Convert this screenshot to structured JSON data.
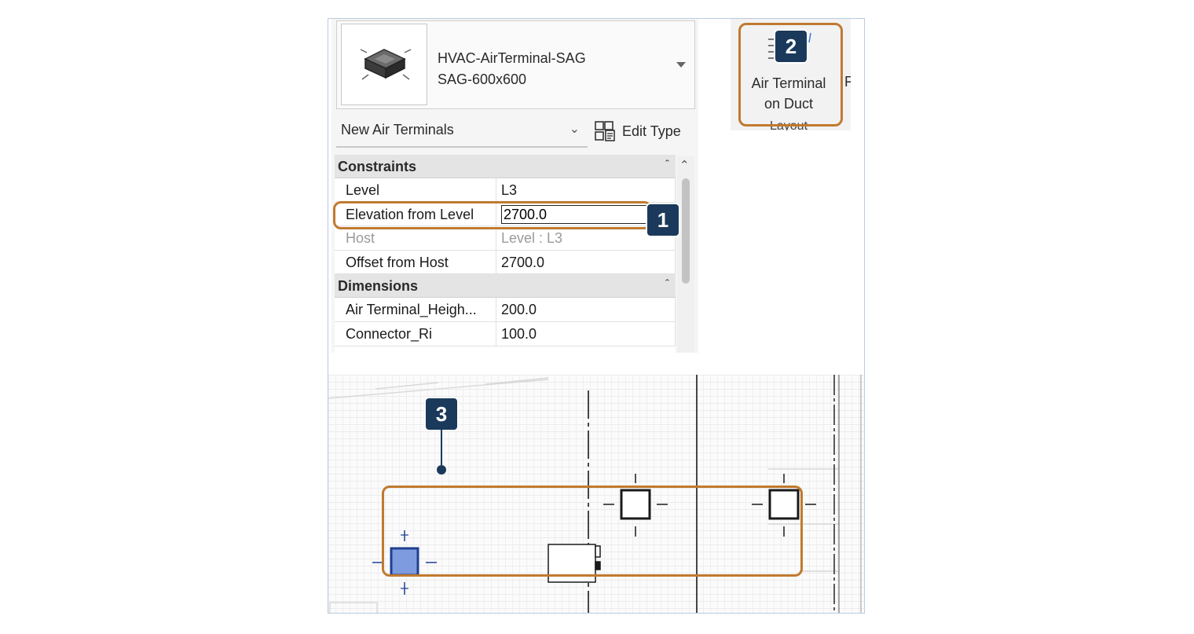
{
  "properties": {
    "type_family": "HVAC-AirTerminal-SAG",
    "type_size": "SAG-600x600",
    "selector": "New Air Terminals",
    "edit_type": "Edit Type",
    "sections": {
      "constraints": "Constraints",
      "dimensions": "Dimensions"
    },
    "constraints": [
      {
        "name": "Level",
        "value": "L3"
      },
      {
        "name": "Elevation from Level",
        "value": "2700.0"
      },
      {
        "name": "Host",
        "value": "Level : L3"
      },
      {
        "name": "Offset from Host",
        "value": "2700.0"
      }
    ],
    "dimensions": [
      {
        "name": "Air Terminal_Heigh...",
        "value": "200.0"
      },
      {
        "name": "Connector_Ri",
        "value": "100.0"
      }
    ]
  },
  "ribbon": {
    "button_line1": "Air Terminal",
    "button_line2": "on Duct",
    "next_partial": "F",
    "panel_label": "Layout"
  },
  "callouts": [
    "1",
    "2",
    "3"
  ],
  "colors": {
    "highlight": "#c07a30",
    "badge": "#1b3a5b",
    "selected_terminal": "#7f9be0"
  }
}
